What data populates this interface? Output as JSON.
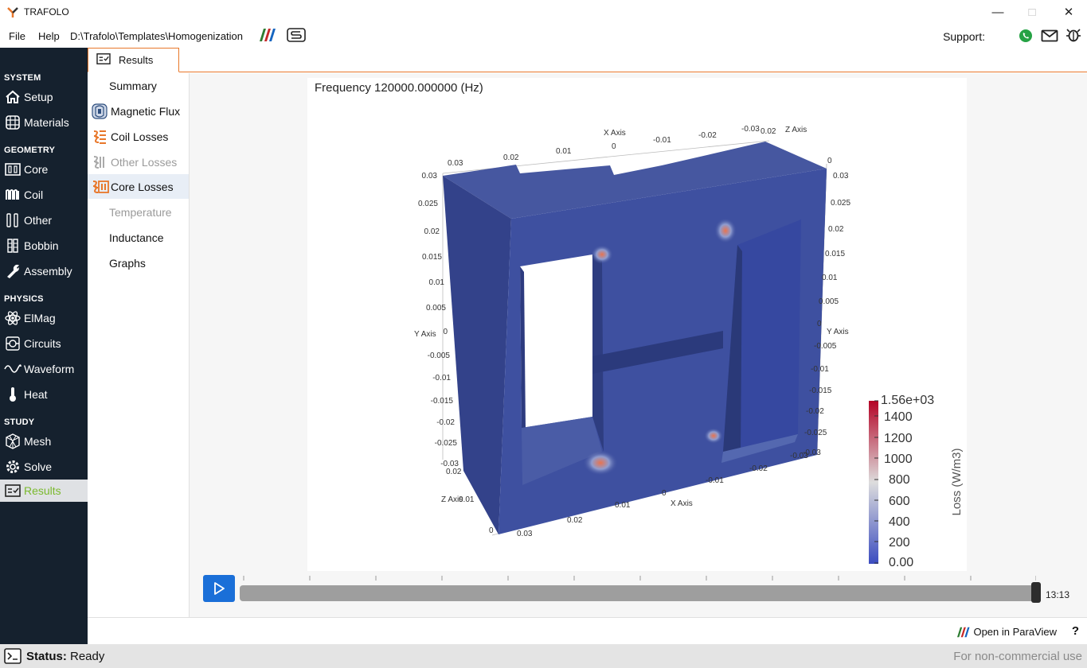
{
  "window": {
    "title": "TRAFOLO"
  },
  "menu": {
    "file": "File",
    "help": "Help",
    "path": "D:\\Trafolo\\Templates\\Homogenization",
    "support_label": "Support:"
  },
  "sidebar": {
    "sections": [
      {
        "title": "SYSTEM",
        "items": [
          {
            "label": "Setup",
            "icon": "home-icon"
          },
          {
            "label": "Materials",
            "icon": "grid-icon"
          }
        ]
      },
      {
        "title": "GEOMETRY",
        "items": [
          {
            "label": "Core",
            "icon": "core-icon"
          },
          {
            "label": "Coil",
            "icon": "coil-icon"
          },
          {
            "label": "Other",
            "icon": "other-icon"
          },
          {
            "label": "Bobbin",
            "icon": "bobbin-icon"
          },
          {
            "label": "Assembly",
            "icon": "wrench-icon"
          }
        ]
      },
      {
        "title": "PHYSICS",
        "items": [
          {
            "label": "ElMag",
            "icon": "atom-icon"
          },
          {
            "label": "Circuits",
            "icon": "circuit-icon"
          },
          {
            "label": "Waveform",
            "icon": "wave-icon"
          },
          {
            "label": "Heat",
            "icon": "thermometer-icon"
          }
        ]
      },
      {
        "title": "STUDY",
        "items": [
          {
            "label": "Mesh",
            "icon": "mesh-icon"
          },
          {
            "label": "Solve",
            "icon": "gear-icon"
          },
          {
            "label": "Results",
            "icon": "results-icon"
          }
        ]
      }
    ]
  },
  "tabs": {
    "active": "Results"
  },
  "results_nav": {
    "items": [
      "Summary",
      "Magnetic Flux",
      "Coil Losses",
      "Other Losses",
      "Core Losses",
      "Temperature",
      "Inductance",
      "Graphs"
    ],
    "selected": "Core Losses",
    "disabled": [
      "Other Losses",
      "Temperature"
    ]
  },
  "viewer": {
    "frequency_label": "Frequency 120000.000000 (Hz)",
    "colorbar": {
      "title": "Loss (W/m3)",
      "max_label": "1.56e+03",
      "ticks": [
        "1400",
        "1200",
        "1000",
        "800",
        "600",
        "400",
        "200",
        "0.00"
      ],
      "color_low": "#3b4cc0",
      "color_mid": "#dddddd",
      "color_high": "#b40426"
    },
    "axes": {
      "x_axis_label": "X Axis",
      "y_axis_label": "Y Axis",
      "z_axis_label": "Z Axis",
      "left_y_ticks": [
        "0.03",
        "0.025",
        "0.02",
        "0.015",
        "0.01",
        "0.005",
        "0",
        "-0.005",
        "-0.01",
        "-0.015",
        "-0.02",
        "-0.025",
        "-0.03"
      ],
      "right_y_ticks": [
        "0.03",
        "0.025",
        "0.02",
        "0.015",
        "0.01",
        "0.005",
        "0",
        "-0.005",
        "-0.01",
        "-0.015",
        "-0.02",
        "-0.025",
        "-0.03"
      ],
      "top_x_ticks": [
        "0.03",
        "0.02",
        "0.01",
        "0",
        "-0.01",
        "-0.02",
        "-0.03"
      ],
      "bottom_x_ticks": [
        "0.03",
        "0.02",
        "0.01",
        "0",
        "-0.01",
        "-0.02",
        "-0.03"
      ],
      "top_z_ticks": [
        "0.02",
        "0"
      ],
      "bottom_z_ticks": [
        "0.02",
        "0.01",
        "0"
      ]
    },
    "core_color": "#3d4f9c"
  },
  "playback": {
    "time": "13:13",
    "progress": 1.0,
    "tick_count": 13
  },
  "footer": {
    "open_paraview": "Open in ParaView",
    "help": "?"
  },
  "status": {
    "label": "Status:",
    "value": "Ready",
    "license": "For non-commercial use"
  },
  "colors": {
    "accent": "#e8772a",
    "sidebar_bg": "#15212e",
    "active_green": "#7ab92d",
    "play_blue": "#1a6fd8"
  }
}
